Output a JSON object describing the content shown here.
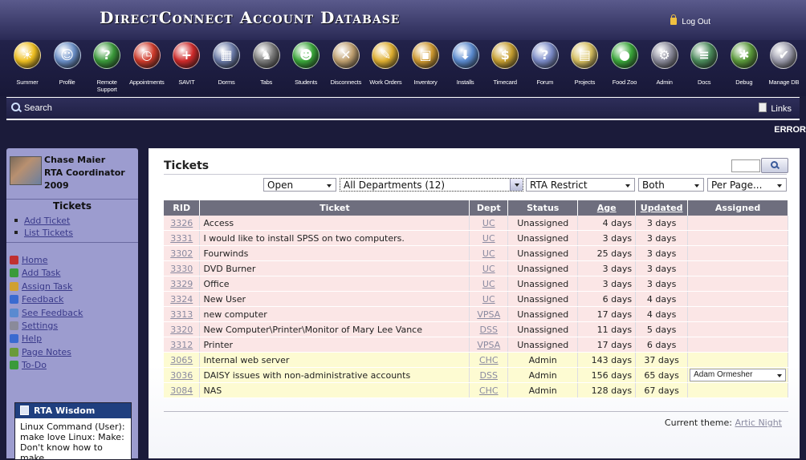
{
  "header": {
    "title": "DirectConnect Account Database",
    "logout_label": "Log Out"
  },
  "nav": [
    {
      "label": "Summer",
      "icon": "sun-sunglasses-icon",
      "glyph": "☀",
      "color": "#f0c020"
    },
    {
      "label": "Profile",
      "icon": "profile-card-icon",
      "glyph": "☺",
      "color": "#6a8fc8"
    },
    {
      "label": "Remote Support",
      "icon": "globe-question-icon",
      "glyph": "?",
      "color": "#3a9a3a"
    },
    {
      "label": "Appointments",
      "icon": "alarm-clock-icon",
      "glyph": "◷",
      "color": "#d03a2a"
    },
    {
      "label": "SAVIT",
      "icon": "medical-cross-icon",
      "glyph": "+",
      "color": "#d02a2a"
    },
    {
      "label": "Dorms",
      "icon": "building-icon",
      "glyph": "▦",
      "color": "#6a7aa8"
    },
    {
      "label": "Tabs",
      "icon": "knight-helmet-icon",
      "glyph": "♞",
      "color": "#7a7a7a"
    },
    {
      "label": "Students",
      "icon": "person-icon",
      "glyph": "☻",
      "color": "#3aa83a"
    },
    {
      "label": "Disconnects",
      "icon": "disconnect-icon",
      "glyph": "✕",
      "color": "#c0a070"
    },
    {
      "label": "Work Orders",
      "icon": "clipboard-icon",
      "glyph": "✎",
      "color": "#e0b030"
    },
    {
      "label": "Inventory",
      "icon": "box-icon",
      "glyph": "▣",
      "color": "#d09a30"
    },
    {
      "label": "Installs",
      "icon": "install-package-icon",
      "glyph": "⬇",
      "color": "#5a8ad0"
    },
    {
      "label": "Timecard",
      "icon": "money-bag-icon",
      "glyph": "$",
      "color": "#c8a030"
    },
    {
      "label": "Forum",
      "icon": "speech-bubble-icon",
      "glyph": "?",
      "color": "#7a8ac8"
    },
    {
      "label": "Projects",
      "icon": "folder-icon",
      "glyph": "▤",
      "color": "#d8c060"
    },
    {
      "label": "Food Zoo",
      "icon": "apple-icon",
      "glyph": "●",
      "color": "#3aa83a"
    },
    {
      "label": "Admin",
      "icon": "gears-icon",
      "glyph": "⚙",
      "color": "#8a8a9a"
    },
    {
      "label": "Docs",
      "icon": "books-icon",
      "glyph": "≡",
      "color": "#4a8a5a"
    },
    {
      "label": "Debug",
      "icon": "bug-icon",
      "glyph": "✱",
      "color": "#5a9a3a"
    },
    {
      "label": "Manage DB",
      "icon": "database-icon",
      "glyph": "✔",
      "color": "#9a9aaa"
    }
  ],
  "searchbar": {
    "search_label": "Search",
    "links_label": "Links"
  },
  "error_text": "ERROR",
  "user": {
    "name": "Chase Maier",
    "role": "RTA Coordinator",
    "year": "2009"
  },
  "sidebar": {
    "section_title": "Tickets",
    "sublinks": [
      "Add Ticket",
      "List Tickets"
    ],
    "links": [
      {
        "label": "Home",
        "icon": "home-icon",
        "color": "#c03030"
      },
      {
        "label": "Add Task",
        "icon": "checkbox-icon",
        "color": "#3a9a3a"
      },
      {
        "label": "Assign Task",
        "icon": "people-icon",
        "color": "#d0a030"
      },
      {
        "label": "Feedback",
        "icon": "info-icon",
        "color": "#3a6ad0"
      },
      {
        "label": "See Feedback",
        "icon": "magnifier-icon",
        "color": "#5a8ad0"
      },
      {
        "label": "Settings",
        "icon": "tools-icon",
        "color": "#8a8a9a"
      },
      {
        "label": "Help",
        "icon": "help-icon",
        "color": "#3a6ad0"
      },
      {
        "label": "Page Notes",
        "icon": "note-icon",
        "color": "#6a9a3a"
      },
      {
        "label": "To-Do",
        "icon": "checklist-icon",
        "color": "#3a9a3a"
      }
    ]
  },
  "wisdom": {
    "title": "RTA Wisdom",
    "text": "Linux Command (User): make love Linux: Make: Don't know how to make"
  },
  "main": {
    "title": "Tickets",
    "filters": {
      "status": "Open",
      "department": "All Departments (12)",
      "restrict": "RTA Restrict",
      "scope": "Both",
      "per_page": "Per Page..."
    },
    "columns": [
      "RID",
      "Ticket",
      "Dept",
      "Status",
      "Age",
      "Updated",
      "Assigned"
    ],
    "rows": [
      {
        "rid": "3326",
        "ticket": "Access",
        "dept": "UC",
        "status": "Unassigned",
        "age": "4 days",
        "updated": "3 days",
        "assigned": "",
        "tone": "pink"
      },
      {
        "rid": "3331",
        "ticket": "I would like to install SPSS on two computers.",
        "dept": "UC",
        "status": "Unassigned",
        "age": "3 days",
        "updated": "3 days",
        "assigned": "",
        "tone": "pink"
      },
      {
        "rid": "3302",
        "ticket": "Fourwinds",
        "dept": "UC",
        "status": "Unassigned",
        "age": "25 days",
        "updated": "3 days",
        "assigned": "",
        "tone": "pink"
      },
      {
        "rid": "3330",
        "ticket": "DVD Burner",
        "dept": "UC",
        "status": "Unassigned",
        "age": "3 days",
        "updated": "3 days",
        "assigned": "",
        "tone": "pink"
      },
      {
        "rid": "3329",
        "ticket": "Office",
        "dept": "UC",
        "status": "Unassigned",
        "age": "3 days",
        "updated": "3 days",
        "assigned": "",
        "tone": "pink"
      },
      {
        "rid": "3324",
        "ticket": "New User",
        "dept": "UC",
        "status": "Unassigned",
        "age": "6 days",
        "updated": "4 days",
        "assigned": "",
        "tone": "pink"
      },
      {
        "rid": "3313",
        "ticket": "new computer",
        "dept": "VPSA",
        "status": "Unassigned",
        "age": "17 days",
        "updated": "4 days",
        "assigned": "",
        "tone": "pink"
      },
      {
        "rid": "3320",
        "ticket": "New Computer\\Printer\\Monitor of Mary Lee Vance",
        "dept": "DSS",
        "status": "Unassigned",
        "age": "11 days",
        "updated": "5 days",
        "assigned": "",
        "tone": "pink"
      },
      {
        "rid": "3312",
        "ticket": "Printer",
        "dept": "VPSA",
        "status": "Unassigned",
        "age": "17 days",
        "updated": "6 days",
        "assigned": "",
        "tone": "pink"
      },
      {
        "rid": "3065",
        "ticket": "Internal web server",
        "dept": "CHC",
        "status": "Admin",
        "age": "143 days",
        "updated": "37 days",
        "assigned": "",
        "tone": "yellow"
      },
      {
        "rid": "3036",
        "ticket": "DAISY issues with non-administrative accounts",
        "dept": "DSS",
        "status": "Admin",
        "age": "156 days",
        "updated": "65 days",
        "assigned": "Adam Ormesher",
        "tone": "yellow"
      },
      {
        "rid": "3084",
        "ticket": "NAS",
        "dept": "CHC",
        "status": "Admin",
        "age": "128 days",
        "updated": "67 days",
        "assigned": "",
        "tone": "yellow"
      }
    ]
  },
  "footer": {
    "theme_label": "Current theme:",
    "theme_name": "Artic Night"
  }
}
